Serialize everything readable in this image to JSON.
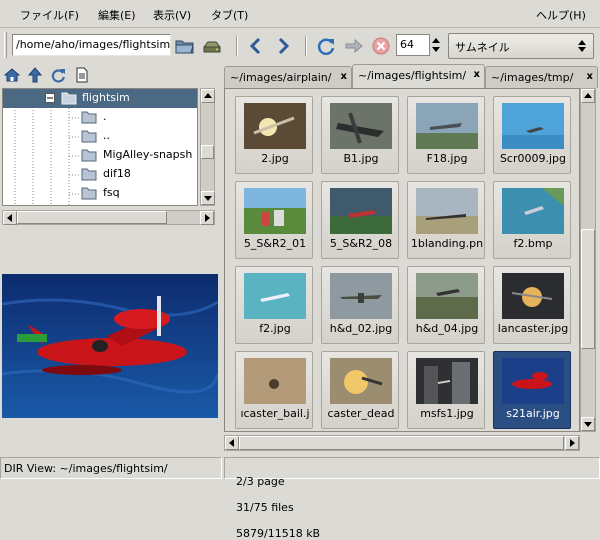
{
  "menu": {
    "file": "ファイル(F)",
    "edit": "編集(E)",
    "view": "表示(V)",
    "tab": "タブ(T)",
    "help": "ヘルプ(H)"
  },
  "toolbar": {
    "path": "/home/aho/images/flightsim/",
    "page_number": "64",
    "view_mode": "サムネイル"
  },
  "tree": {
    "items": [
      {
        "label": "flightsim"
      },
      {
        "label": "."
      },
      {
        "label": ".."
      },
      {
        "label": "MigAlley-snapsh"
      },
      {
        "label": "dif18"
      },
      {
        "label": "fsq"
      }
    ]
  },
  "tabs": [
    {
      "label": "~/images/airplain/"
    },
    {
      "label": "~/images/flightsim/"
    },
    {
      "label": "~/images/tmp/"
    }
  ],
  "thumbnails": [
    {
      "name": "2.jpg"
    },
    {
      "name": "B1.jpg"
    },
    {
      "name": "F18.jpg"
    },
    {
      "name": "Scr0009.jpg"
    },
    {
      "name": "5_S&R2_01"
    },
    {
      "name": "5_S&R2_08"
    },
    {
      "name": "1blanding.pn"
    },
    {
      "name": "f2.bmp"
    },
    {
      "name": "f2.jpg"
    },
    {
      "name": "h&d_02.jpg"
    },
    {
      "name": "h&d_04.jpg"
    },
    {
      "name": "lancaster.jpg"
    },
    {
      "name": "ıcaster_bail.j"
    },
    {
      "name": "caster_dead"
    },
    {
      "name": "msfs1.jpg"
    },
    {
      "name": "s21air.jpg"
    }
  ],
  "status": {
    "dir_view": "DIR View: ~/images/flightsim/",
    "page": "2/3 page",
    "files": "31/75 files",
    "size": "5879/11518 kB"
  },
  "colors": {
    "selection": "#4b6983",
    "thumb_selected": "#2b4e83",
    "window_bg": "#dcdad5"
  }
}
